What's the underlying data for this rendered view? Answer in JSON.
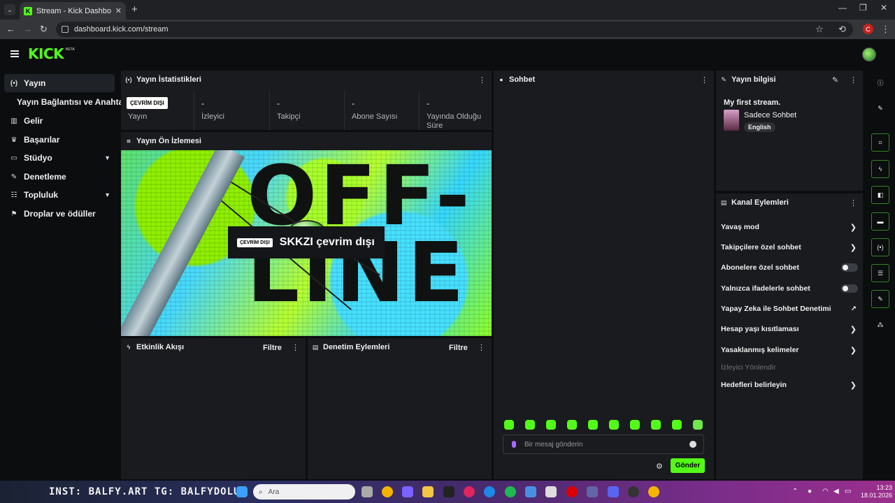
{
  "browser": {
    "tab_title": "Stream - Kick Dashboard",
    "url": "dashboard.kick.com/stream",
    "profile_initial": "C"
  },
  "header": {
    "logo": "KICK",
    "beta": "BETA"
  },
  "sidebar": {
    "items": [
      {
        "label": "Yayın",
        "icon": "broadcast-icon"
      },
      {
        "label": "Yayın Bağlantısı ve Anahtarı"
      },
      {
        "label": "Gelir",
        "icon": "chart-icon"
      },
      {
        "label": "Başarılar",
        "icon": "trophy-icon"
      },
      {
        "label": "Stüdyo",
        "icon": "studio-icon"
      },
      {
        "label": "Denetleme",
        "icon": "wrench-icon"
      },
      {
        "label": "Topluluk",
        "icon": "community-icon"
      },
      {
        "label": "Droplar ve ödüller",
        "icon": "drops-icon"
      }
    ]
  },
  "stats": {
    "title": "Yayın İstatistikleri",
    "badge": "ÇEVRİM DIŞI",
    "items": [
      {
        "value": "",
        "label": "Yayın"
      },
      {
        "value": "-",
        "label": "İzleyici"
      },
      {
        "value": "-",
        "label": "Takipçi"
      },
      {
        "value": "-",
        "label": "Abone Sayısı"
      },
      {
        "value": "-",
        "label": "Yayında Olduğu Süre"
      }
    ]
  },
  "preview": {
    "title": "Yayın Ön İzlemesi",
    "big_text": "OFF-LINE",
    "badge": "ÇEVRİM DIŞI",
    "status_text": "SKKZI çevrim dışı"
  },
  "activity": {
    "title": "Etkinlik Akışı",
    "filter": "Filtre"
  },
  "moderation": {
    "title": "Denetim Eylemleri",
    "filter": "Filtre"
  },
  "chat": {
    "title": "Sohbet",
    "placeholder": "Bir mesaj gönderin",
    "send": "Gönder"
  },
  "stream_info": {
    "title": "Yayın bilgisi",
    "stream_title": "My first stream.",
    "category": "Sadece Sohbet",
    "language": "English"
  },
  "channel_actions": {
    "title": "Kanal Eylemleri",
    "items": [
      {
        "label": "Yavaş mod",
        "control": "chevron"
      },
      {
        "label": "Takipçilere özel sohbet",
        "control": "chevron"
      },
      {
        "label": "Abonelere özel sohbet",
        "control": "toggle",
        "enabled": false
      },
      {
        "label": "Yalnızca ifadelerle sohbet",
        "control": "toggle",
        "enabled": false
      },
      {
        "label": "Yapay Zeka ile Sohbet Denetimi",
        "control": "external"
      },
      {
        "label": "Hesap yaşı kısıtlaması",
        "control": "chevron"
      },
      {
        "label": "Yasaklanmış kelimeler",
        "control": "chevron"
      },
      {
        "label": "İzleyici Yönlendir",
        "control": "none",
        "disabled": true
      },
      {
        "label": "Hedefleri belirleyin",
        "control": "chevron"
      }
    ]
  },
  "taskbar": {
    "overlay_text": "INST: BALFY.ART TG: BALFYDOLUR",
    "search_placeholder": "Ara",
    "time": "13:23",
    "date": "18.01.2026"
  },
  "colors": {
    "accent": "#53fc18",
    "panel": "#191b1f",
    "background": "#0b0d0f"
  }
}
